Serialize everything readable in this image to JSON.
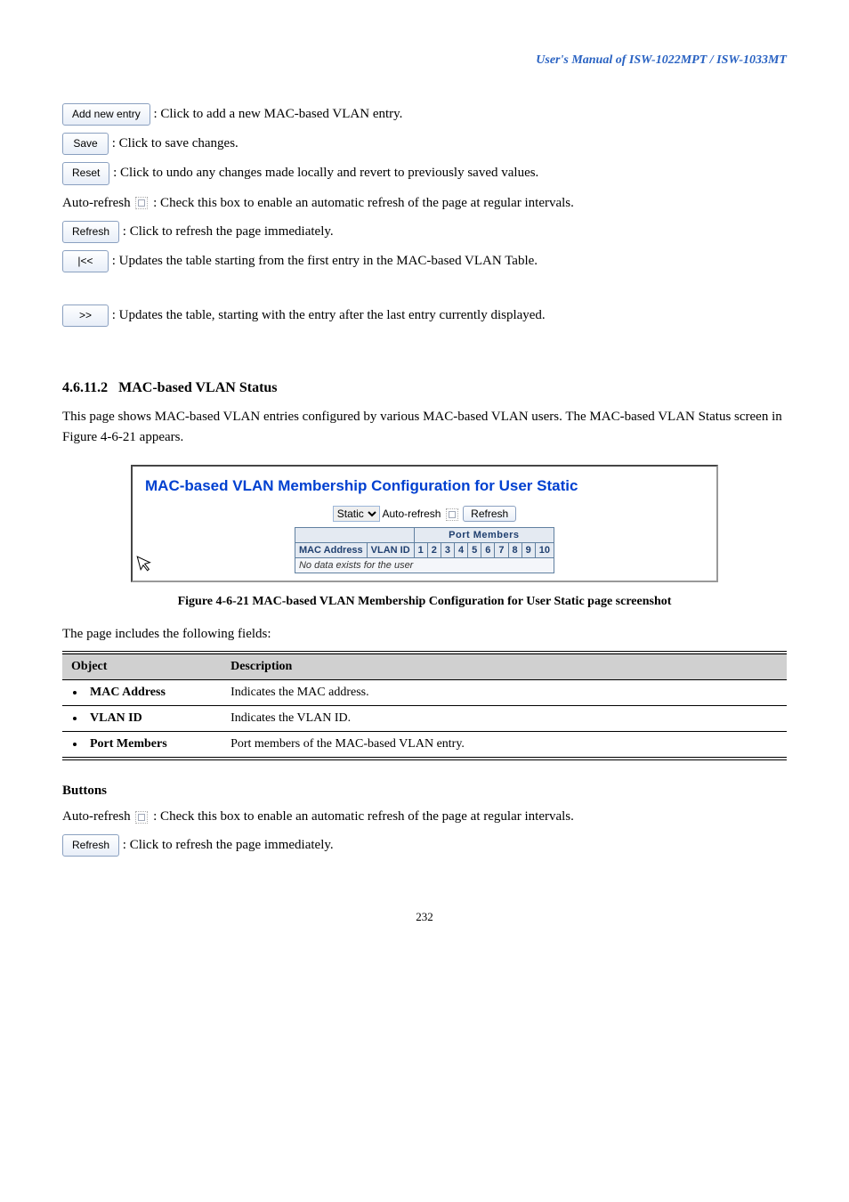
{
  "header": "User's Manual of ISW-1022MPT / ISW-1033MT",
  "btnRows": [
    {
      "btn": "Add new entry",
      "text": ": Click to add a new MAC-based VLAN entry."
    },
    {
      "btn": "Save",
      "text": ": Click to save changes."
    },
    {
      "btn": "Reset",
      "text": ": Click to undo any changes made locally and revert to previously saved values."
    }
  ],
  "autoRefresh": {
    "label": "Auto-refresh",
    "text": ": Check this box to enable an automatic refresh of the page at regular intervals."
  },
  "navRows": [
    {
      "btn": "Refresh",
      "text": ": Click to refresh the page immediately."
    },
    {
      "btn": "|<<",
      "text": ": Updates the table starting from the first entry in the MAC-based VLAN Table."
    },
    {
      "btn": ">>",
      "text": ": Updates the table, starting with the entry after the last entry currently displayed."
    }
  ],
  "section": {
    "number": "4.6.11.2",
    "title": "MAC-based VLAN Status",
    "para": "This page shows MAC-based VLAN entries configured by various MAC-based VLAN users. The MAC-based VLAN Status screen in ",
    "figRefA": "Figure 4-6-21",
    "paraTail": " appears."
  },
  "figure": {
    "title": "MAC-based VLAN Membership Configuration for User Static",
    "dropdown": "Static",
    "autoRefresh": "Auto-refresh",
    "refreshBtn": "Refresh",
    "portMembersLabel": "Port Members",
    "cols": [
      "MAC Address",
      "VLAN ID",
      "1",
      "2",
      "3",
      "4",
      "5",
      "6",
      "7",
      "8",
      "9",
      "10"
    ],
    "emptyMsg": "No data exists for the user",
    "caption": "Figure 4-6-21 MAC-based VLAN Membership Configuration for User Static page screenshot"
  },
  "objTable": {
    "intro": "The page includes the following fields:",
    "head": [
      "Object",
      "Description"
    ],
    "rows": [
      {
        "obj": "MAC Address",
        "desc": "Indicates the MAC address."
      },
      {
        "obj": "VLAN ID",
        "desc": "Indicates the VLAN ID."
      },
      {
        "obj": "Port Members",
        "desc": "Port members of the MAC-based VLAN entry."
      }
    ]
  },
  "buttonsLabel": "Buttons",
  "autoRefresh2": {
    "label": "Auto-refresh",
    "text": ": Check this box to enable an automatic refresh of the page at regular intervals."
  },
  "refresh2": {
    "btn": "Refresh",
    "text": ": Click to refresh the page immediately."
  },
  "pageNum": "232"
}
